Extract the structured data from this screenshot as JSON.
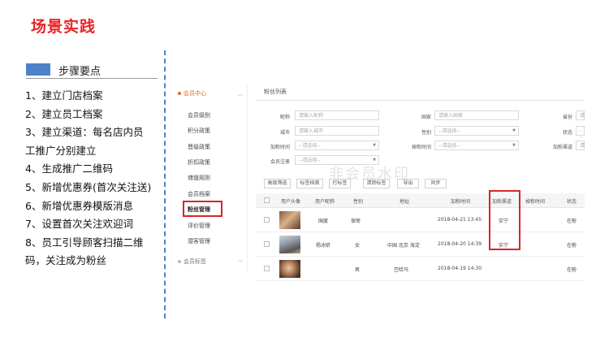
{
  "slide": {
    "title": "场景实践",
    "steps_heading": "步骤要点",
    "steps": [
      "1、建立门店档案",
      "2、建立员工档案",
      "3、建立渠道：每名店内员",
      "工推广分别建立",
      "4、生成推广二维码",
      "5、新增优惠券(首次关注送)",
      "6、新增优惠券模版消息",
      "7、设置首次关注欢迎词",
      "8、员工引导顾客扫描二维",
      "码，关注成为粉丝"
    ]
  },
  "sidebar": {
    "section": "会员中心",
    "items": [
      "会员级别",
      "积分政策",
      "晋级政策",
      "折扣政策",
      "储值规则",
      "会员档案",
      "粉丝管理",
      "评价管理",
      "潜客管理"
    ],
    "active": "粉丝管理",
    "section2": "会员标签"
  },
  "content": {
    "tab": "粉丝列表",
    "filters": {
      "nickname_label": "昵称",
      "nickname_placeholder": "请输入昵称",
      "country_label": "国家",
      "country_placeholder": "请输入国家",
      "province_label": "省份",
      "province_partial": "请",
      "city_label": "城市",
      "city_placeholder": "请输入城市",
      "gender_label": "性别",
      "gender_value": "--请选择--",
      "status_label": "状态",
      "status_partial": "--",
      "follow_time_label": "加粉时间",
      "follow_time_value": "--请选择--",
      "unfollow_time_label": "掉粉时间",
      "unfollow_time_value": "--请选择--",
      "channel_label": "加粉渠道",
      "channel_partial": "请",
      "member_reg_label": "会员注册",
      "member_reg_value": "--请选择--"
    },
    "buttons": [
      "高级筛选",
      "标签档案",
      "打标签",
      "清除标签",
      "导出",
      "同步"
    ],
    "watermark": "非会员水印",
    "columns": [
      "用户头像",
      "用户昵称",
      "性别",
      "地址",
      "加粉时间",
      "加粉渠道",
      "掉粉时间",
      "状态"
    ],
    "rows": [
      {
        "nickname": "国度",
        "gender": "保密",
        "address": "",
        "follow_time": "2018-04-21 13:45",
        "channel": "实宁",
        "unfollow_time": "",
        "status": "在粉"
      },
      {
        "nickname": "杨冰昕",
        "gender": "女",
        "address": "中国 北京 海淀",
        "follow_time": "2018-04-20 14:39",
        "channel": "实宁",
        "unfollow_time": "",
        "status": "在粉"
      },
      {
        "nickname": "",
        "gender": "男",
        "address": "巴哈马",
        "follow_time": "2018-04-19 14:30",
        "channel": "",
        "unfollow_time": "",
        "status": "在粉"
      }
    ]
  },
  "colors": {
    "title_red": "#e8252a",
    "accent_blue": "#4f81c7",
    "highlight_red": "#d9252a",
    "menu_orange": "#e56a1f"
  }
}
